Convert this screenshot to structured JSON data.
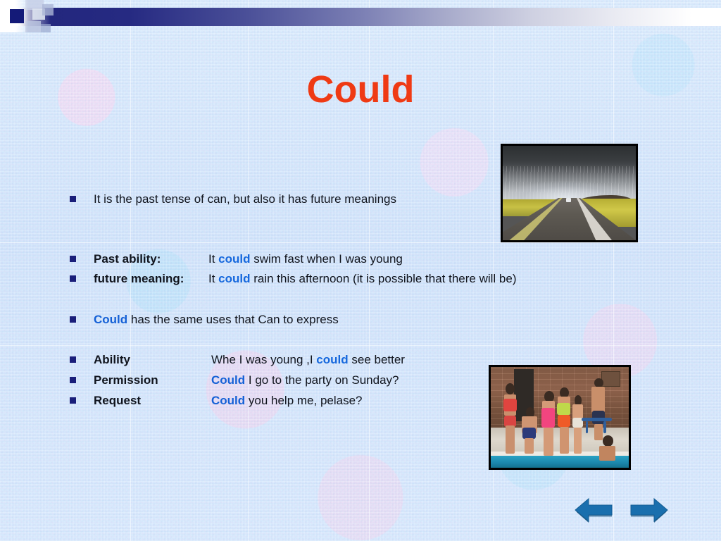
{
  "slide": {
    "title": "Could",
    "title_color": "#ef3a14",
    "accent_blue": "#1668dd",
    "bullet_color": "#1a1f7a",
    "body_text_color": "#10141d"
  },
  "content_blocks": [
    {
      "id": "intro",
      "bullet": "■",
      "label": "",
      "text": "It is the past tense of can, but also it has future meanings"
    },
    {
      "id": "past-ability",
      "bullet": "■",
      "label": "Past ability:",
      "text_before": "It ",
      "keyword": "could",
      "text_after": " swim fast when I was young"
    },
    {
      "id": "future-meaning",
      "bullet": "■",
      "label": "future meaning:",
      "text_before": "It ",
      "keyword": "could",
      "text_after": " rain this afternoon (it is possible that there will be)"
    },
    {
      "id": "same-uses",
      "bullet": "■",
      "label": "",
      "keyword": "Could",
      "text_after": " has the same uses that Can to express"
    },
    {
      "id": "ability",
      "bullet": "■",
      "label": "Ability",
      "text_before": "Whe I was young ,I ",
      "keyword": "could",
      "text_after": " see better"
    },
    {
      "id": "permission",
      "bullet": "■",
      "label": "Permission",
      "text_before": "",
      "keyword": "Could",
      "text_after": " I go to the party on Sunday?"
    },
    {
      "id": "request",
      "bullet": "■",
      "label": "Request",
      "text_before": "",
      "keyword": "Could",
      "text_after": " you help me, pelase?"
    }
  ],
  "images": [
    {
      "id": "storm-photo",
      "name": "storm-over-highway-photo",
      "description": "Dark storm clouds and rain over a straight highway through yellow fields"
    },
    {
      "id": "pool-photo",
      "name": "swimming-pool-children-photo",
      "description": "Children in swimsuits standing at the edge of an indoor swimming pool"
    }
  ],
  "navigation": {
    "previous_label": "Previous slide",
    "next_label": "Next slide",
    "arrow_color": "#1a6fae"
  },
  "decor": {
    "band_dark_color": "#23277e",
    "band_square_color": "#141a78"
  }
}
